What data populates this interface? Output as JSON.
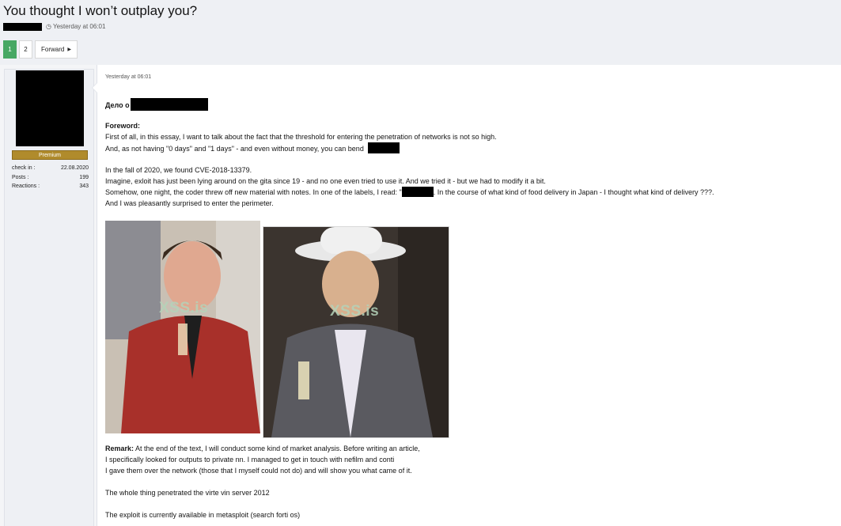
{
  "thread": {
    "title": "You thought I won’t outplay you?",
    "author_redacted": "",
    "timestamp": "Yesterday at 06:01"
  },
  "pagination": {
    "pages": [
      "1",
      "2"
    ],
    "active_page": "1",
    "forward_label": "Forward"
  },
  "user": {
    "banner": "Premium",
    "stats": [
      {
        "label": "check in :",
        "value": "22.08.2020"
      },
      {
        "label": "Posts :",
        "value": "199"
      },
      {
        "label": "Reactions :",
        "value": "343"
      }
    ]
  },
  "post": {
    "date": "Yesterday at 06:01",
    "heading_prefix": "Дело о",
    "foreword_label": "Foreword:",
    "lines": {
      "l1": "First of all, in this essay, I want to talk about the fact that the threshold for entering the penetration of networks is not so high.",
      "l2": "And, as not having \"0 days\" and \"1 days\" - and even without money, you can bend",
      "l3": "In the fall of 2020, we found CVE-2018-13379.",
      "l4": "Imagine, exloit has just been lying around on the gita since 19 - and no one even tried to use it. And we tried it - but we had to modify it a bit.",
      "l5a": "Somehow, one night, the coder threw off new material with notes. In one of the labels, I read: \"",
      "l5b": ". In the course of what kind of food delivery in Japan - I thought what kind of delivery ???.",
      "l6": "And I was pleasantly surprised to enter the perimeter."
    },
    "image_watermark": "XSS.is",
    "remark_label": "Remark:",
    "remark_lines": [
      "At the end of the text, I will conduct some kind of market analysis. Before writing an article,",
      "I specifically looked for outputs to private nn. I managed to get in touch with nefilm and conti",
      "I gave them over the network (those that I myself could not do) and will show you what came of it."
    ],
    "p_vpn": "The whole thing penetrated the virte vin server 2012",
    "p_exploit": "The exploit is currently available in metasploit (search forti os)"
  },
  "colors": {
    "active_page": "#47a864",
    "banner": "#b08b2c",
    "topbar": "#eef0f4"
  }
}
